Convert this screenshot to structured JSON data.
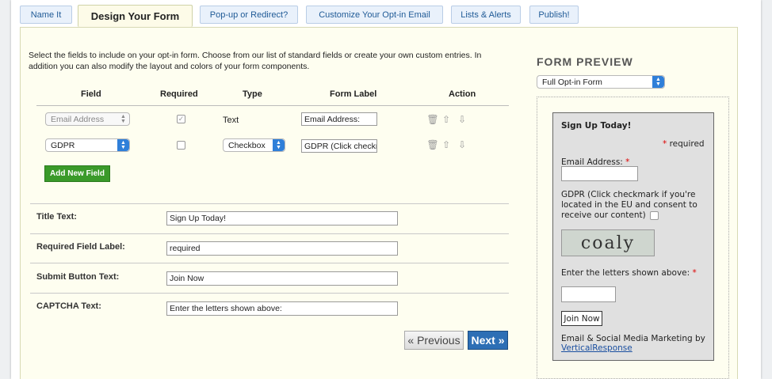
{
  "tabs": [
    {
      "label": "Name It"
    },
    {
      "label": "Design Your Form"
    },
    {
      "label": "Pop-up or Redirect?"
    },
    {
      "label": "Customize Your Opt-in Email"
    },
    {
      "label": "Lists & Alerts"
    },
    {
      "label": "Publish!"
    }
  ],
  "intro": "Select the fields to include on your opt-in form. Choose from our list of standard fields or create your own custom entries. In addition you can also modify the layout and colors of your form components.",
  "table": {
    "headers": {
      "field": "Field",
      "required": "Required",
      "type": "Type",
      "form_label": "Form Label",
      "action": "Action"
    },
    "rows": [
      {
        "field": "Email Address",
        "required": true,
        "type": "Text",
        "form_label": "Email Address:"
      },
      {
        "field": "GDPR",
        "required": false,
        "type": "Checkbox",
        "form_label": "GDPR (Click checkmark"
      }
    ]
  },
  "add_field_button": "Add New Field",
  "settings": [
    {
      "label": "Title Text:",
      "value": "Sign Up Today!"
    },
    {
      "label": "Required Field Label:",
      "value": "required"
    },
    {
      "label": "Submit Button Text:",
      "value": "Join Now"
    },
    {
      "label": "CAPTCHA Text:",
      "value": "Enter the letters shown above:"
    }
  ],
  "nav": {
    "previous": "« Previous",
    "next": "Next »"
  },
  "preview": {
    "heading": "FORM PREVIEW",
    "select_value": "Full Opt-in Form",
    "title": "Sign Up Today!",
    "required_mark": "*",
    "required_label": "required",
    "email_label": "Email Address:",
    "gdpr_label": "GDPR (Click checkmark if you're located in the EU and consent to receive our content)",
    "captcha_text": "coaly",
    "captcha_prompt": "Enter the letters shown above:",
    "submit": "Join Now",
    "footer_text": "Email & Social Media Marketing by",
    "footer_link": "VerticalResponse"
  },
  "icons": {
    "delete": "trash-icon",
    "up": "arrow-up-icon",
    "down": "arrow-down-icon"
  },
  "colors": {
    "accent": "#2d6fb5",
    "add_button": "#3a9a2a",
    "required": "#dd0000"
  }
}
